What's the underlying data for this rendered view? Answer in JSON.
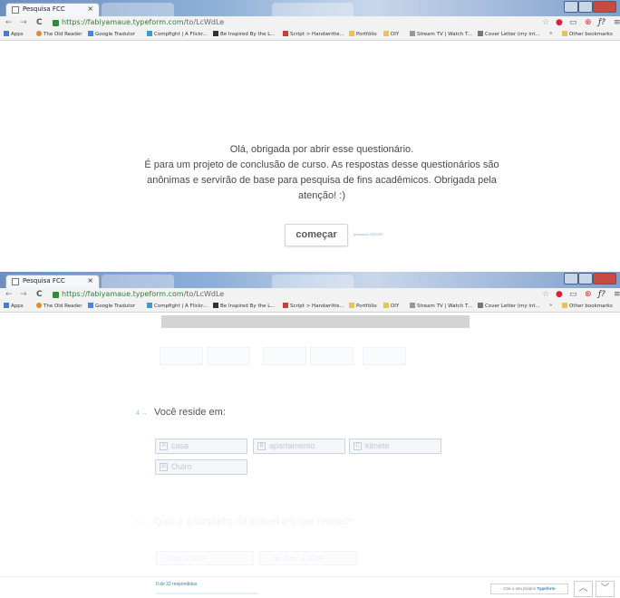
{
  "browser": {
    "tab_title": "Pesquisa FCC",
    "tab_close": "×",
    "url_host": "https://fabiyamaue.typeform.com",
    "url_path": "/to/LcWdLe",
    "nav": {
      "back": "←",
      "forward": "→",
      "reload": "C"
    },
    "bookmarks": [
      "Apps",
      "The Old Reader",
      "Google Tradutor",
      "Compfight | A Flickr...",
      "Be Inspired By the L...",
      "Script > Handwritte...",
      "Portfólio",
      "DIY",
      "Stream TV | Watch T...",
      "Cover Letter (my int...",
      "»",
      "Other bookmarks"
    ]
  },
  "welcome": {
    "line1": "Olá, obrigada por abrir esse questionário.",
    "line2": "É para um projeto de conclusão de curso. As respostas desse questionários são",
    "line3": "anônimas e servirão de base para pesquisa de fins acadêmicos. Obrigada pela",
    "line4": "atenção! :)",
    "start_button": "começar",
    "enter_hint": "pressione ENTER"
  },
  "question4": {
    "number": "4 →",
    "text": "Você reside em:",
    "choices": [
      {
        "key": "A",
        "label": "casa"
      },
      {
        "key": "B",
        "label": "apartamento"
      },
      {
        "key": "C",
        "label": "kitnete"
      },
      {
        "key": "D",
        "label": "Outro"
      }
    ]
  },
  "question5": {
    "number": "5 →",
    "text": "Qual é o tamanho do imóvel em que reside?*",
    "options": [
      "0m² a 30m²",
      "de 30m² a 60m²"
    ]
  },
  "footer": {
    "progress_text": "0 de 22 respondidas",
    "progress_fraction": 0.0,
    "typeform_prefix": "Crie o seu próprio ",
    "typeform_brand": "Typeform",
    "up_arrow": "︿",
    "down_arrow": "﹀"
  }
}
